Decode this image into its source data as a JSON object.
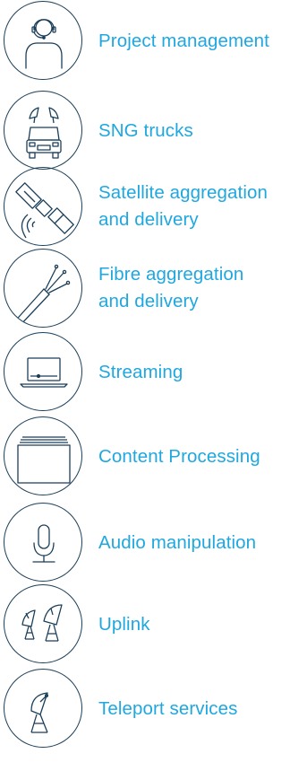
{
  "services": [
    {
      "icon": "headset-person-icon",
      "lines": [
        "Project management"
      ]
    },
    {
      "icon": "sng-truck-icon",
      "lines": [
        "SNG trucks"
      ]
    },
    {
      "icon": "satellite-icon",
      "lines": [
        "Satellite aggregation",
        "and delivery"
      ]
    },
    {
      "icon": "fibre-cable-icon",
      "lines": [
        "Fibre aggregation",
        "and delivery"
      ]
    },
    {
      "icon": "laptop-stream-icon",
      "lines": [
        "Streaming"
      ]
    },
    {
      "icon": "stacked-windows-icon",
      "lines": [
        "Content Processing"
      ]
    },
    {
      "icon": "microphone-icon",
      "lines": [
        "Audio manipulation"
      ]
    },
    {
      "icon": "satellite-dishes-icon",
      "lines": [
        "Uplink"
      ]
    },
    {
      "icon": "satellite-dish-icon",
      "lines": [
        "Teleport services"
      ]
    }
  ],
  "colors": {
    "label": "#1fa7e0",
    "icon_stroke": "#1b3f5a"
  }
}
